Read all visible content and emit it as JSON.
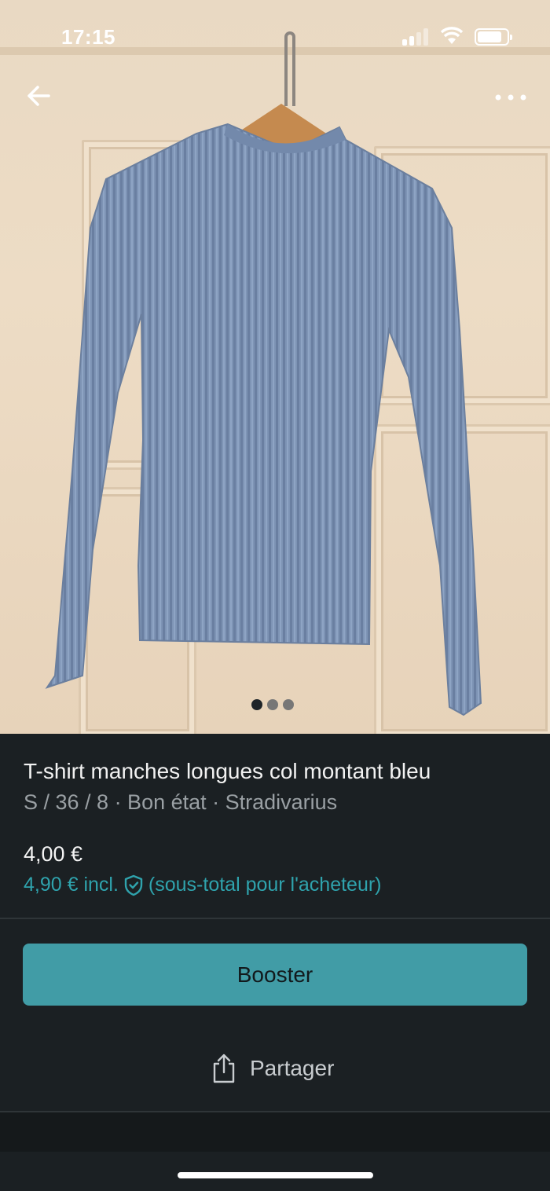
{
  "status_bar": {
    "time": "17:15"
  },
  "carousel": {
    "image_count": 3,
    "active_index": 0
  },
  "navigation": {
    "back_icon": "arrow-left-icon",
    "more_icon": "more-horizontal-icon"
  },
  "item": {
    "title": "T-shirt manches longues col montant bleu",
    "subtitle": "S / 36 / 8 · Bon état · Stradivarius",
    "price": "4,00 €",
    "buyer_price": "4,90 € incl.",
    "buyer_note": "(sous-total pour l'acheteur)"
  },
  "actions": {
    "booster_label": "Booster",
    "share_label": "Partager"
  },
  "colors": {
    "accent": "#419ca6",
    "link": "#2fa3ad",
    "background": "#1b2023"
  }
}
